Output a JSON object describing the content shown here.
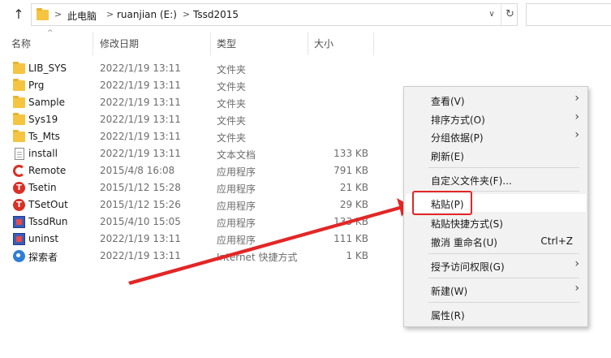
{
  "address_bar": {
    "breadcrumbs": [
      "此电脑",
      "ruanjian (E:)",
      "Tssd2015"
    ],
    "separator": ">"
  },
  "columns": {
    "name": "名称",
    "date": "修改日期",
    "type": "类型",
    "size": "大小"
  },
  "files": [
    {
      "name": "LIB_SYS",
      "date": "2022/1/19 13:11",
      "type": "文件夹",
      "size": "",
      "icon": "folder-icon"
    },
    {
      "name": "Prg",
      "date": "2022/1/19 13:11",
      "type": "文件夹",
      "size": "",
      "icon": "folder-icon"
    },
    {
      "name": "Sample",
      "date": "2022/1/19 13:11",
      "type": "文件夹",
      "size": "",
      "icon": "folder-icon"
    },
    {
      "name": "Sys19",
      "date": "2022/1/19 13:11",
      "type": "文件夹",
      "size": "",
      "icon": "folder-icon"
    },
    {
      "name": "Ts_Mts",
      "date": "2022/1/19 13:11",
      "type": "文件夹",
      "size": "",
      "icon": "folder-icon"
    },
    {
      "name": "install",
      "date": "2022/1/19 13:11",
      "type": "文本文档",
      "size": "133 KB",
      "icon": "text-document-icon"
    },
    {
      "name": "Remote",
      "date": "2015/4/8 16:08",
      "type": "应用程序",
      "size": "791 KB",
      "icon": "app-logo-icon"
    },
    {
      "name": "Tsetin",
      "date": "2015/1/12 15:28",
      "type": "应用程序",
      "size": "21 KB",
      "icon": "app-t-icon"
    },
    {
      "name": "TSetOut",
      "date": "2015/1/12 15:26",
      "type": "应用程序",
      "size": "29 KB",
      "icon": "app-t-icon"
    },
    {
      "name": "TssdRun",
      "date": "2015/4/10 15:05",
      "type": "应用程序",
      "size": "133 KB",
      "icon": "installer-icon"
    },
    {
      "name": "uninst",
      "date": "2022/1/19 13:11",
      "type": "应用程序",
      "size": "111 KB",
      "icon": "installer-icon"
    },
    {
      "name": "探索者",
      "date": "2022/1/19 13:11",
      "type": "Internet 快捷方式",
      "size": "1 KB",
      "icon": "internet-shortcut-icon"
    }
  ],
  "context_menu": {
    "items": [
      {
        "label": "查看(V)",
        "submenu": true
      },
      {
        "label": "排序方式(O)",
        "submenu": true
      },
      {
        "label": "分组依据(P)",
        "submenu": true
      },
      {
        "label": "刷新(E)",
        "submenu": false
      },
      {
        "label": "自定义文件夹(F)...",
        "submenu": false
      },
      {
        "label": "粘贴(P)",
        "submenu": false,
        "highlighted": true
      },
      {
        "label": "粘贴快捷方式(S)",
        "submenu": false
      },
      {
        "label": "撤消 重命名(U)",
        "submenu": false,
        "shortcut": "Ctrl+Z"
      },
      {
        "label": "授予访问权限(G)",
        "submenu": true
      },
      {
        "label": "新建(W)",
        "submenu": true
      },
      {
        "label": "属性(R)",
        "submenu": false
      }
    ]
  },
  "colors": {
    "accent_red": "#e32626",
    "folder_yellow": "#f5c542",
    "menu_bg": "#f2f2f2"
  }
}
